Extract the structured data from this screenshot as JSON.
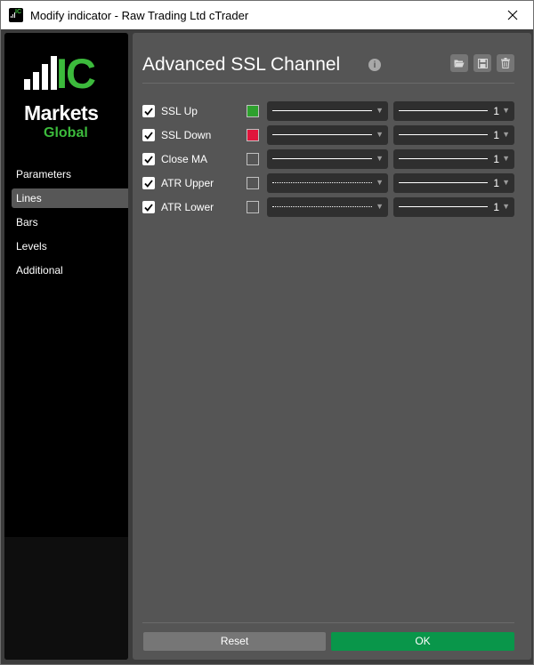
{
  "window": {
    "title": "Modify indicator - Raw Trading Ltd cTrader"
  },
  "logo": {
    "brand_ic": "IC",
    "brand_markets": "Markets",
    "brand_global": "Global",
    "accent_color": "#3cba3c"
  },
  "sidebar": {
    "items": [
      {
        "label": "Parameters",
        "active": false
      },
      {
        "label": "Lines",
        "active": true
      },
      {
        "label": "Bars",
        "active": false
      },
      {
        "label": "Levels",
        "active": false
      },
      {
        "label": "Additional",
        "active": false
      }
    ]
  },
  "header": {
    "title": "Advanced SSL Channel",
    "info_icon": "info-icon",
    "actions": [
      "folder-open-icon",
      "save-icon",
      "trash-icon"
    ]
  },
  "lines": [
    {
      "label": "SSL Up",
      "checked": true,
      "color": "#2ea12e",
      "style": "solid",
      "width": "1"
    },
    {
      "label": "SSL Down",
      "checked": true,
      "color": "#e0153c",
      "style": "solid",
      "width": "1"
    },
    {
      "label": "Close MA",
      "checked": true,
      "color": "#555555",
      "style": "solid",
      "width": "1"
    },
    {
      "label": "ATR Upper",
      "checked": true,
      "color": "#555555",
      "style": "dotted",
      "width": "1"
    },
    {
      "label": "ATR Lower",
      "checked": true,
      "color": "#555555",
      "style": "dotted",
      "width": "1"
    }
  ],
  "footer": {
    "reset_label": "Reset",
    "ok_label": "OK",
    "ok_color": "#09964a"
  }
}
